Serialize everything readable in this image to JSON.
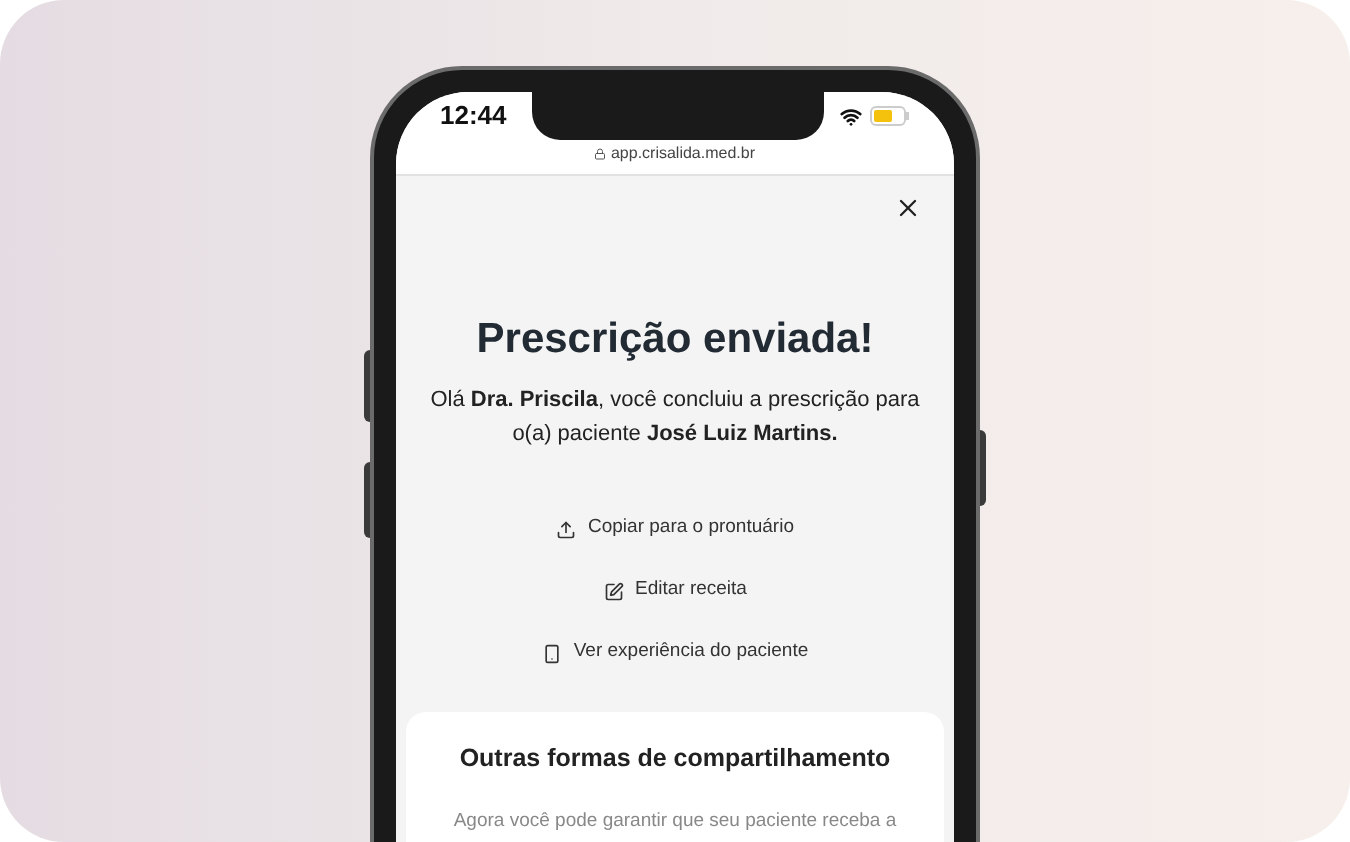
{
  "status_bar": {
    "time": "12:44"
  },
  "browser": {
    "url": "app.crisalida.med.br"
  },
  "screen": {
    "title": "Prescrição enviada!",
    "message": "Olá **Dra. Priscila**, você concluiu a prescrição para o(a) paciente **José Luiz Martins.**",
    "actions": [
      {
        "kind": "upload",
        "label": "Copiar para o prontuário"
      },
      {
        "kind": "edit",
        "label": "Editar receita"
      },
      {
        "kind": "phone",
        "label": "Ver experiência do paciente"
      }
    ],
    "share_card": {
      "title": "Outras formas de compartilhamento",
      "text": "Agora você pode garantir que seu paciente receba a"
    }
  }
}
